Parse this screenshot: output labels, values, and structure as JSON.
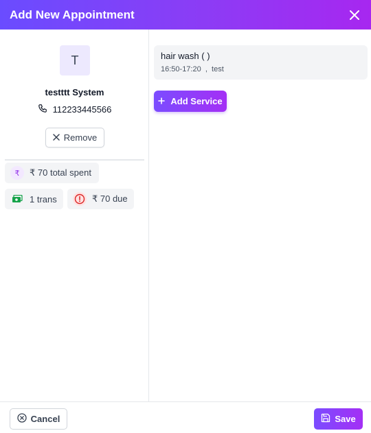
{
  "header": {
    "title": "Add New Appointment",
    "close_icon": "close-icon"
  },
  "customer": {
    "initial": "T",
    "name": "testttt System",
    "phone": "112233445566",
    "remove_label": "Remove"
  },
  "stats": {
    "total_spent": "₹ 70 total spent",
    "transactions": "1 trans",
    "due": "₹ 70 due"
  },
  "services": [
    {
      "name": "hair wash ( )",
      "time": "16:50-17:20",
      "staff": "test"
    }
  ],
  "add_service_label": "Add Service",
  "footer": {
    "cancel_label": "Cancel",
    "save_label": "Save"
  },
  "colors": {
    "accent_start": "#6a4cff",
    "accent_end": "#a727f0",
    "success": "#16a34a",
    "danger": "#dc2626"
  }
}
